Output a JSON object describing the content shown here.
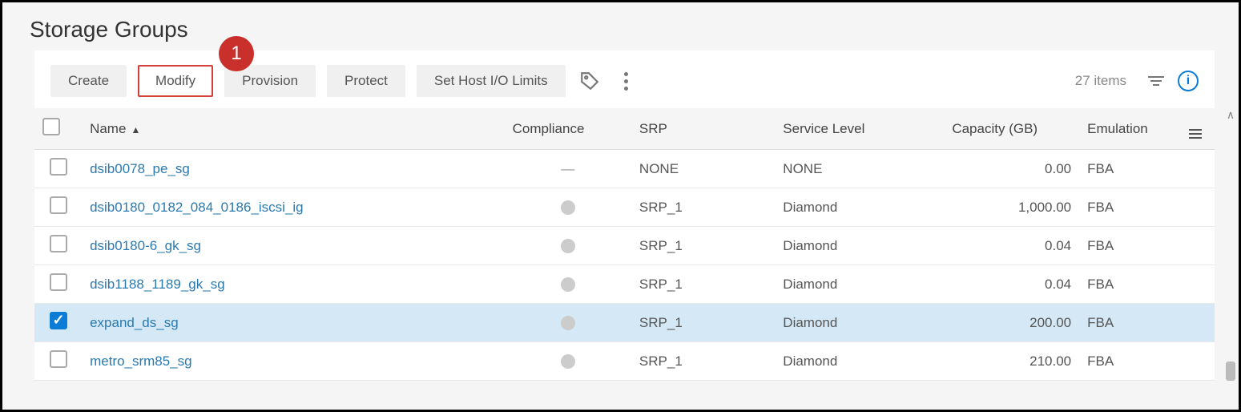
{
  "page": {
    "title": "Storage Groups"
  },
  "annotation": {
    "label": "1"
  },
  "toolbar": {
    "create": "Create",
    "modify": "Modify",
    "provision": "Provision",
    "protect": "Protect",
    "set_limits": "Set Host I/O Limits",
    "items_count": "27 items"
  },
  "columns": {
    "name": "Name",
    "compliance": "Compliance",
    "srp": "SRP",
    "service_level": "Service Level",
    "capacity": "Capacity (GB)",
    "emulation": "Emulation"
  },
  "rows": [
    {
      "checked": false,
      "name": "dsib0078_pe_sg",
      "compliance": "dash",
      "srp": "NONE",
      "service_level": "NONE",
      "capacity": "0.00",
      "emulation": "FBA",
      "selected": false
    },
    {
      "checked": false,
      "name": "dsib0180_0182_084_0186_iscsi_ig",
      "compliance": "dot",
      "srp": "SRP_1",
      "service_level": "Diamond",
      "capacity": "1,000.00",
      "emulation": "FBA",
      "selected": false
    },
    {
      "checked": false,
      "name": "dsib0180-6_gk_sg",
      "compliance": "dot",
      "srp": "SRP_1",
      "service_level": "Diamond",
      "capacity": "0.04",
      "emulation": "FBA",
      "selected": false
    },
    {
      "checked": false,
      "name": "dsib1188_1189_gk_sg",
      "compliance": "dot",
      "srp": "SRP_1",
      "service_level": "Diamond",
      "capacity": "0.04",
      "emulation": "FBA",
      "selected": false
    },
    {
      "checked": true,
      "name": "expand_ds_sg",
      "compliance": "dot",
      "srp": "SRP_1",
      "service_level": "Diamond",
      "capacity": "200.00",
      "emulation": "FBA",
      "selected": true
    },
    {
      "checked": false,
      "name": "metro_srm85_sg",
      "compliance": "dot",
      "srp": "SRP_1",
      "service_level": "Diamond",
      "capacity": "210.00",
      "emulation": "FBA",
      "selected": false
    }
  ]
}
